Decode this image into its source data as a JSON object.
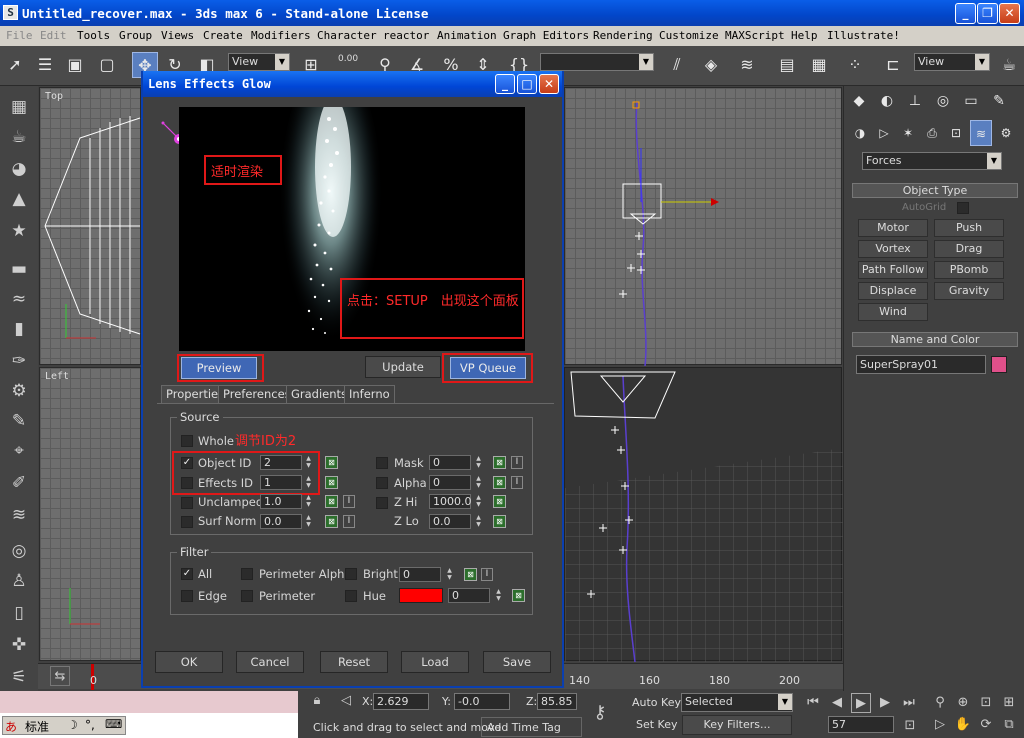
{
  "window": {
    "title": "Untitled_recover.max - 3ds max 6 - Stand-alone License",
    "icon": "3ds-max-icon"
  },
  "menu": [
    "File",
    "Edit",
    "Tools",
    "Group",
    "Views",
    "Create",
    "Modifiers",
    "Character",
    "reactor",
    "Animation",
    "Graph Editors",
    "Rendering",
    "Customize",
    "MAXScript",
    "Help",
    "Illustrate!"
  ],
  "toolbar": {
    "view_combo_left": "View",
    "view_combo_right": "View",
    "numeric": "0.00"
  },
  "viewports": {
    "top_label": "Top",
    "left_label": "Left"
  },
  "right_panel": {
    "category_combo": "Forces",
    "object_type_header": "Object Type",
    "autogrid_label": "AutoGrid",
    "buttons": [
      "Motor",
      "Push",
      "Vortex",
      "Drag",
      "Path Follow",
      "PBomb",
      "Displace",
      "Gravity",
      "Wind"
    ],
    "name_color_header": "Name and Color",
    "object_name": "SuperSpray01",
    "object_color": "#e0508a"
  },
  "dialog": {
    "title": "Lens Effects Glow",
    "buttons": {
      "preview": "Preview",
      "update": "Update",
      "vp_queue": "VP Queue"
    },
    "tabs": [
      "Properties",
      "Preferences",
      "Gradients",
      "Inferno"
    ],
    "source": {
      "title": "Source",
      "whole": "Whole",
      "object_id_label": "Object ID",
      "object_id_value": "2",
      "effects_id_label": "Effects ID",
      "effects_id_value": "1",
      "unclamped_label": "Unclamped",
      "unclamped_value": "1.0",
      "surf_norm_label": "Surf Norm",
      "surf_norm_value": "0.0",
      "mask_label": "Mask",
      "mask_value": "0",
      "alpha_label": "Alpha",
      "alpha_value": "0",
      "zhi_label": "Z Hi",
      "zhi_value": "1000.0",
      "zlo_label": "Z Lo",
      "zlo_value": "0.0",
      "i_glyph": "I"
    },
    "filter": {
      "title": "Filter",
      "all": "All",
      "perimeter_alpha": "Perimeter Alpha",
      "bright": "Bright",
      "bright_value": "0",
      "edge": "Edge",
      "perimeter": "Perimeter",
      "hue": "Hue",
      "hue_value": "0",
      "hue_color": "#ff0000"
    },
    "footer": [
      "OK",
      "Cancel",
      "Reset",
      "Load",
      "Save"
    ]
  },
  "annotations": {
    "render": "适时渲染",
    "setup": "点击：SETUP　出现这个面板",
    "id": "调节ID为2"
  },
  "timeline": {
    "frame_start": "0",
    "labels": [
      "140",
      "160",
      "180",
      "200"
    ]
  },
  "status": {
    "x_label": "X:",
    "x_value": "2.629",
    "y_label": "Y:",
    "y_value": "-0.0",
    "z_label": "Z:",
    "z_value": "85.85",
    "prompt": "Click and drag to select and move",
    "add_time_tag": "Add Time Tag",
    "auto_key": "Auto Key",
    "selected_combo": "Selected",
    "set_key": "Set Key",
    "key_filters": "Key Filters...",
    "frame": "57",
    "ime_label": "标准"
  }
}
